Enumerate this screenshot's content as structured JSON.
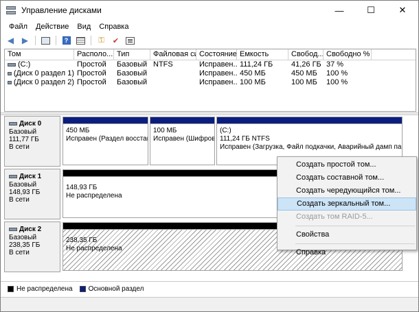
{
  "window": {
    "title": "Управление дисками",
    "minimize": "—",
    "maximize": "☐",
    "close": "✕"
  },
  "menu": [
    "Файл",
    "Действие",
    "Вид",
    "Справка"
  ],
  "volumes": {
    "headers": [
      "Том",
      "Располо...",
      "Тип",
      "Файловая сист...",
      "Состояние",
      "Емкость",
      "Свобод...",
      "Свободно %"
    ],
    "rows": [
      [
        "(C:)",
        "Простой",
        "Базовый",
        "NTFS",
        "Исправен...",
        "111,24 ГБ",
        "41,26 ГБ",
        "37 %"
      ],
      [
        "(Диск 0 раздел 1)",
        "Простой",
        "Базовый",
        "",
        "Исправен...",
        "450 МБ",
        "450 МБ",
        "100 %"
      ],
      [
        "(Диск 0 раздел 2)",
        "Простой",
        "Базовый",
        "",
        "Исправен...",
        "100 МБ",
        "100 МБ",
        "100 %"
      ]
    ]
  },
  "disks": [
    {
      "name": "Диск 0",
      "type": "Базовый",
      "size": "111,77 ГБ",
      "status": "В сети",
      "partitions": [
        {
          "title": "",
          "size": "450 МБ",
          "desc": "Исправен (Раздел восстановления)"
        },
        {
          "title": "",
          "size": "100 МБ",
          "desc": "Исправен (Шифрованный (EFI) системный раздел)"
        },
        {
          "title": "(C:)",
          "size": "111,24 ГБ NTFS",
          "desc": "Исправен (Загрузка, Файл подкачки, Аварийный дамп памяти, Основной раздел)"
        }
      ]
    },
    {
      "name": "Диск 1",
      "type": "Базовый",
      "size": "148,93 ГБ",
      "status": "В сети",
      "partitions": [
        {
          "size": "148,93 ГБ",
          "desc": "Не распределена"
        }
      ]
    },
    {
      "name": "Диск 2",
      "type": "Базовый",
      "size": "238,35 ГБ",
      "status": "В сети",
      "partitions": [
        {
          "size": "238,35 ГБ",
          "desc": "Не распределена"
        }
      ]
    }
  ],
  "legend": [
    {
      "label": "Не распределена",
      "color": "#000000"
    },
    {
      "label": "Основной раздел",
      "color": "#0b1e7f"
    }
  ],
  "context_menu": {
    "items": [
      {
        "label": "Создать простой том...",
        "state": "normal"
      },
      {
        "label": "Создать составной том...",
        "state": "normal"
      },
      {
        "label": "Создать чередующийся том...",
        "state": "normal"
      },
      {
        "label": "Создать зеркальный том...",
        "state": "highlighted"
      },
      {
        "label": "Создать том RAID-5...",
        "state": "disabled"
      },
      {
        "label": "Свойства",
        "state": "normal"
      },
      {
        "label": "Справка",
        "state": "normal"
      }
    ]
  },
  "colors": {
    "primary_partition": "#0b1e7f",
    "unallocated": "#000000",
    "menu_highlight": "#cde4f7"
  }
}
